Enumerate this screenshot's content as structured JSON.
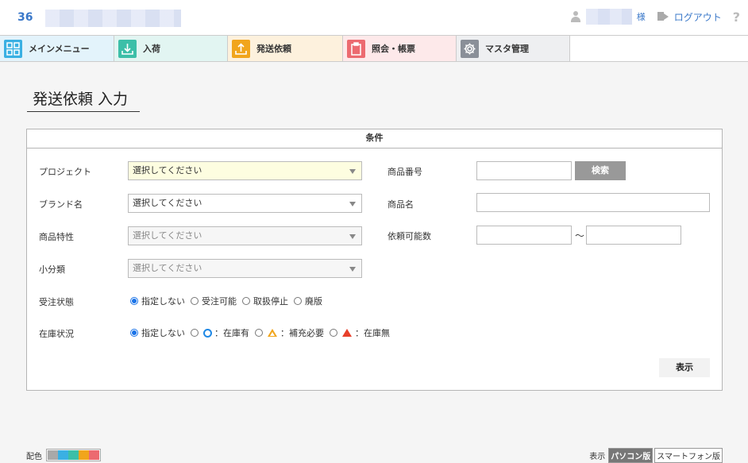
{
  "header": {
    "company_code": "36",
    "honorific": "様",
    "logout_label": "ログアウト",
    "help_label": "?"
  },
  "nav": {
    "items": [
      {
        "label": "メインメニュー",
        "icon": "grid-icon",
        "color": "#3ab0e3"
      },
      {
        "label": "入荷",
        "icon": "download-icon",
        "color": "#3cbfa8"
      },
      {
        "label": "発送依頼",
        "icon": "upload-icon",
        "color": "#f1a51c"
      },
      {
        "label": "照会・帳票",
        "icon": "clipboard-icon",
        "color": "#ec6a70"
      },
      {
        "label": "マスタ管理",
        "icon": "gear-icon",
        "color": "#8a8f98"
      }
    ]
  },
  "page": {
    "title": "発送依頼 入力"
  },
  "conditions": {
    "heading": "条件",
    "project_label": "プロジェクト",
    "project_value": "選択してください",
    "brand_label": "ブランド名",
    "brand_value": "選択してください",
    "characteristic_label": "商品特性",
    "characteristic_value": "選択してください",
    "subcategory_label": "小分類",
    "subcategory_value": "選択してください",
    "product_number_label": "商品番号",
    "product_number_value": "",
    "search_label": "検索",
    "product_name_label": "商品名",
    "product_name_value": "",
    "available_qty_label": "依頼可能数",
    "available_qty_from": "",
    "range_sep": "～",
    "available_qty_to": "",
    "order_status_label": "受注状態",
    "order_status_options": [
      "指定しない",
      "受注可能",
      "取扱停止",
      "廃版"
    ],
    "order_status_selected": "指定しない",
    "stock_status_label": "在庫状況",
    "stock_status_options": [
      "指定しない",
      "：在庫有",
      "：補充必要",
      "：在庫無"
    ],
    "stock_status_selected": "指定しない",
    "show_label": "表示"
  },
  "footer": {
    "color_label": "配色",
    "swatch_colors": [
      "#a9a9a9",
      "#3ab0e3",
      "#3cbfa8",
      "#f1a51c",
      "#ec6a70"
    ],
    "display_label": "表示",
    "pc_label": "パソコン版",
    "sp_label": "スマートフォン版"
  }
}
